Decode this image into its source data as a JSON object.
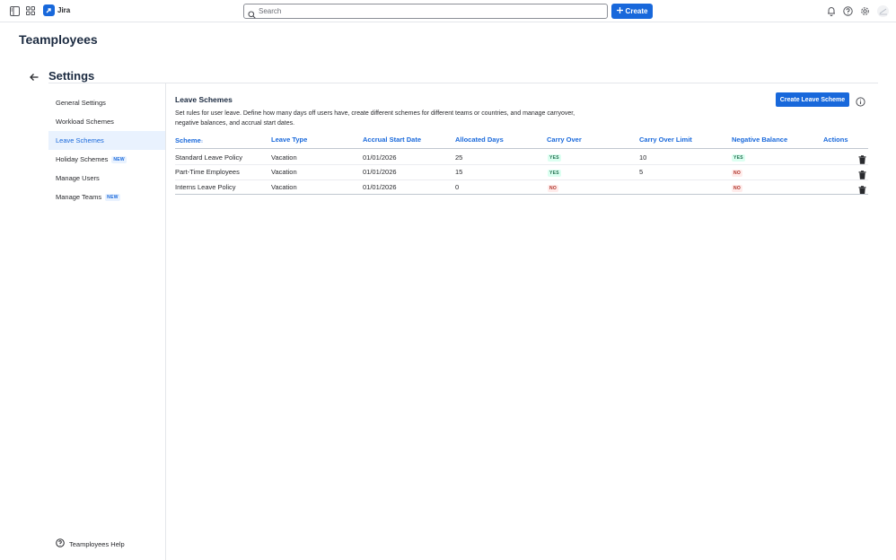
{
  "topbar": {
    "app_name": "Jira",
    "search_placeholder": "Search",
    "create_label": "Create"
  },
  "app_title": "Teamployees",
  "settings_title": "Settings",
  "sidebar": {
    "items": [
      {
        "label": "General Settings",
        "badge": ""
      },
      {
        "label": "Workload Schemes",
        "badge": ""
      },
      {
        "label": "Leave Schemes",
        "badge": ""
      },
      {
        "label": "Holiday Schemes",
        "badge": "NEW"
      },
      {
        "label": "Manage Users",
        "badge": ""
      },
      {
        "label": "Manage Teams",
        "badge": "NEW"
      }
    ],
    "active_index": 2,
    "help_label": "Teamployees Help"
  },
  "main": {
    "title": "Leave Schemes",
    "description": "Set rules for user leave. Define how many days off users have, create different schemes for different teams or countries, and manage carryover, negative balances, and accrual start dates.",
    "create_button": "Create Leave Scheme",
    "table": {
      "headers": [
        "Scheme",
        "Leave Type",
        "Accrual Start Date",
        "Allocated Days",
        "Carry Over",
        "Carry Over Limit",
        "Negative Balance",
        "Actions"
      ],
      "sort_indicator": "↕",
      "rows": [
        {
          "scheme": "Standard Leave Policy",
          "leave_type": "Vacation",
          "accrual_start": "01/01/2026",
          "allocated_days": "25",
          "carry_over": "YES",
          "carry_over_limit": "10",
          "negative_balance": "YES"
        },
        {
          "scheme": "Part-Time Employees",
          "leave_type": "Vacation",
          "accrual_start": "01/01/2026",
          "allocated_days": "15",
          "carry_over": "YES",
          "carry_over_limit": "5",
          "negative_balance": "NO"
        },
        {
          "scheme": "Interns Leave Policy",
          "leave_type": "Vacation",
          "accrual_start": "01/01/2026",
          "allocated_days": "0",
          "carry_over": "NO",
          "carry_over_limit": "",
          "negative_balance": "NO"
        }
      ]
    }
  },
  "colors": {
    "accent": "#1868db",
    "yes_text": "#216e4e",
    "no_text": "#ae2e24"
  },
  "icons": [
    "sidebar-toggle-icon",
    "app-switcher-icon",
    "jira-logo-icon",
    "search-icon",
    "plus-icon",
    "bell-icon",
    "help-icon",
    "gear-icon",
    "avatar",
    "back-arrow-icon",
    "info-icon",
    "trash-icon",
    "help-circle-icon"
  ]
}
